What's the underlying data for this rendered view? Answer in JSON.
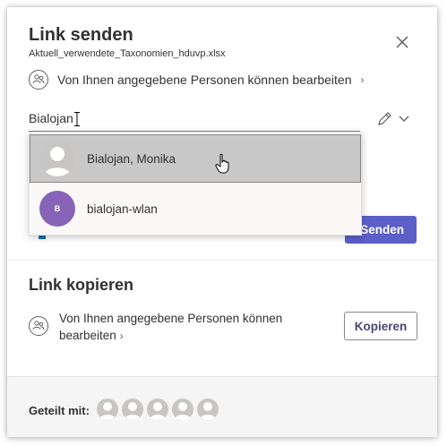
{
  "dialog": {
    "title": "Link senden",
    "filename": "Aktuell_verwendete_Taxonomien_hduvp.xlsx",
    "permission": "Von Ihnen angegebene Personen können bearbeiten",
    "permission_icon": "people-icon",
    "close_icon": "close-icon"
  },
  "recipient_input": {
    "value": "Bialojan"
  },
  "suggestions": [
    {
      "name": "Bialojan, Monika",
      "avatar": "person-silhouette"
    },
    {
      "name": "bialojan-wlan",
      "initial": "B",
      "avatar_color": "#8764b8"
    }
  ],
  "send_button": "Senden",
  "copy_section": {
    "title": "Link kopieren",
    "permission_line1": "Von Ihnen angegebene Personen können",
    "permission_line2": "bearbeiten",
    "copy_button": "Kopieren"
  },
  "footer": {
    "shared_label": "Geteilt mit:",
    "shared_count": 5
  },
  "colors": {
    "accent": "#5b5fc7",
    "text": "#323130",
    "avatar_b": "#8764b8"
  }
}
